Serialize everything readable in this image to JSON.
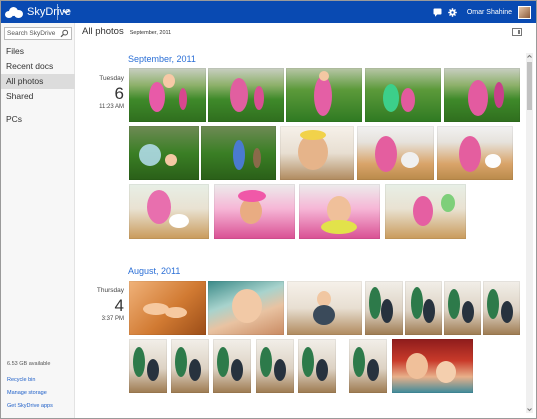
{
  "header": {
    "brand": "SkyDrive",
    "user_name": "Omar Shahine"
  },
  "sidebar": {
    "search_placeholder": "Search SkyDrive",
    "nav": [
      {
        "label": "Files"
      },
      {
        "label": "Recent docs"
      },
      {
        "label": "All photos",
        "active": true
      },
      {
        "label": "Shared"
      },
      {
        "label": "PCs"
      }
    ],
    "storage": "6.53 GB available",
    "links": [
      "Recycle bin",
      "Manage storage",
      "Get SkyDrive apps"
    ]
  },
  "main": {
    "title": "All photos",
    "subtitle": "September, 2011",
    "sections": [
      {
        "heading": "September, 2011",
        "weekday": "Tuesday",
        "day": "6",
        "time": "11:23 AM"
      },
      {
        "heading": "August, 2011",
        "weekday": "Thursday",
        "day": "4",
        "time": "3:37 PM"
      }
    ]
  },
  "colors": {
    "topbar": "#094ab2",
    "accent": "#2b6fd6",
    "link": "#1e5fc8",
    "sidebar_bg": "#f7f7f7",
    "active_nav": "#dcdcdc"
  },
  "icons": {
    "brand": "cloud-icon",
    "app_menu": "chevron-down-icon",
    "messages": "chat-icon",
    "settings": "gear-icon",
    "search": "search-icon",
    "details_pane": "details-pane-icon"
  }
}
